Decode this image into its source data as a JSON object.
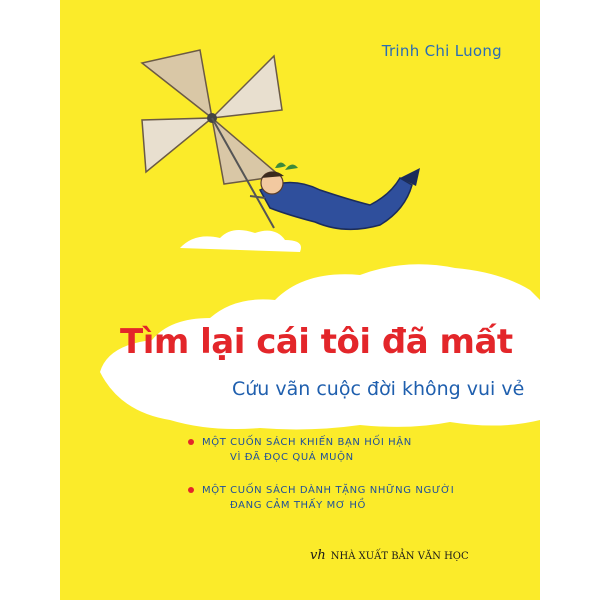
{
  "cover": {
    "author": "Trinh Chi Luong",
    "title": "Tìm lại cái tôi đã mất",
    "subtitle": "Cứu vãn cuộc đời không vui vẻ",
    "bullets": [
      {
        "line1": "MỘT CUỐN SÁCH KHIẾN BẠN HỐI HẬN",
        "line2": "VÌ ĐÃ ĐỌC QUÁ MUỘN"
      },
      {
        "line1": "MỘT CUỐN SÁCH DÀNH TẶNG NHỮNG NGƯỜI",
        "line2": "ĐANG CẢM THẤY MƠ HỒ"
      }
    ],
    "publisher_logo": "vh",
    "publisher_name": "NHÀ XUẤT BẢN VĂN HỌC"
  },
  "colors": {
    "background": "#fbeb2a",
    "title": "#e3262a",
    "subtitle": "#1f5fae",
    "author": "#2a6cb5",
    "bullet_dot": "#e3262a"
  },
  "icons": [
    "pinwheel-illustration",
    "flying-boy-illustration",
    "cloud-shape"
  ]
}
